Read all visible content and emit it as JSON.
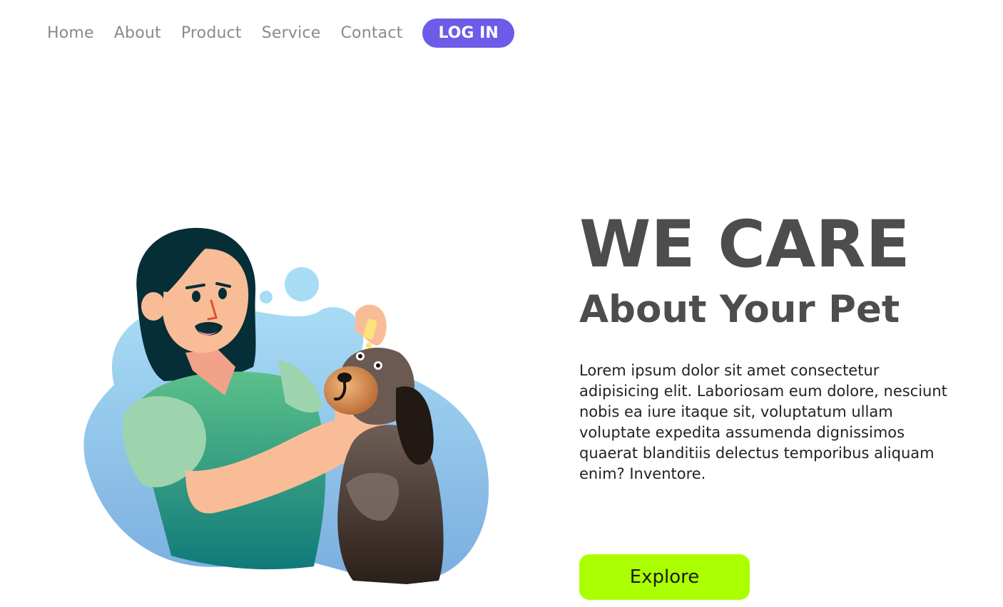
{
  "nav": {
    "links": [
      {
        "label": "Home"
      },
      {
        "label": "About"
      },
      {
        "label": "Product"
      },
      {
        "label": "Service"
      },
      {
        "label": "Contact"
      }
    ],
    "login_label": "LOG IN"
  },
  "hero": {
    "title": "WE CARE",
    "subtitle": "About Your Pet",
    "description": "Lorem ipsum dolor sit amet consectetur adipisicing elit. Laboriosam eum dolore, nesciunt nobis ea iure itaque sit, voluptatum ullam voluptate expedita assumenda dignissimos quaerat blanditiis delectus temporibus aliquam enim? Inventore.",
    "explore_label": "Explore"
  },
  "colors": {
    "accent": "#6c5ce7",
    "cta": "#aaff00",
    "heading": "#4d4d4d",
    "nav_text": "#8a8a8a",
    "blob": "#8ec5ec"
  },
  "illustration": {
    "subject": "woman giving eye drops to dog"
  }
}
